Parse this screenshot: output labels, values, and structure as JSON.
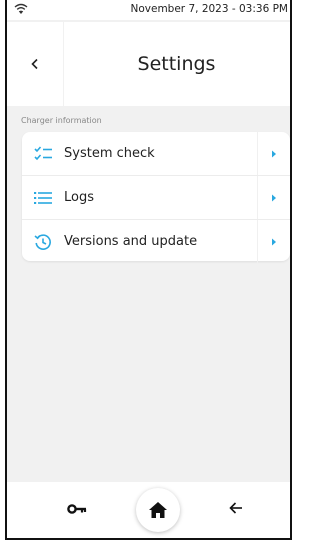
{
  "status_bar": {
    "datetime": "November 7, 2023 - 03:36 PM",
    "wifi_icon": "wifi-icon"
  },
  "header": {
    "title": "Settings",
    "back_icon": "chevron-left-icon"
  },
  "section": {
    "label": "Charger information"
  },
  "menu": [
    {
      "label": "System check",
      "icon": "checklist-icon"
    },
    {
      "label": "Logs",
      "icon": "list-icon"
    },
    {
      "label": "Versions and update",
      "icon": "history-icon"
    }
  ],
  "bottom_nav": {
    "left_icon": "key-icon",
    "center_icon": "home-icon",
    "right_icon": "arrow-left-icon"
  },
  "colors": {
    "accent": "#29a8e0",
    "background": "#f1f1f1",
    "card": "#ffffff",
    "text": "#222222"
  }
}
